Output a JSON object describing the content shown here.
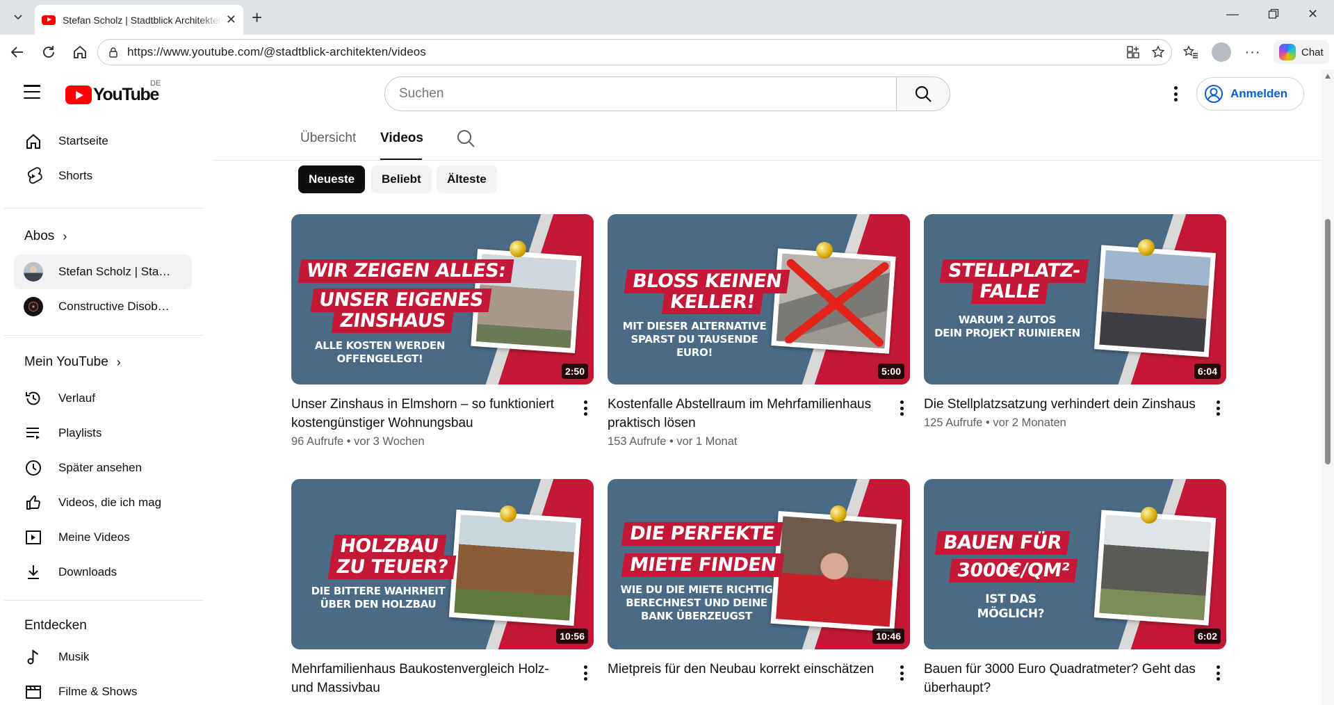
{
  "browser": {
    "tab_title": "Stefan Scholz | Stadtblick Architekten",
    "url_prefix": "https://",
    "url_host": "www.youtube.com",
    "url_path": "/@stadtblick-architekten/videos",
    "chat_label": "Chat"
  },
  "header": {
    "logo_text": "YouTube",
    "country_code": "DE",
    "search_placeholder": "Suchen",
    "signin_label": "Anmelden"
  },
  "sidebar": {
    "main": [
      {
        "label": "Startseite",
        "icon": "home-icon"
      },
      {
        "label": "Shorts",
        "icon": "shorts-icon"
      }
    ],
    "subs_heading": "Abos",
    "subs": [
      {
        "label": "Stefan Scholz | Stadtblick Architekten"
      },
      {
        "label": "Constructive Disobedience"
      }
    ],
    "you_heading": "Mein YouTube",
    "you": [
      {
        "label": "Verlauf",
        "icon": "history-icon"
      },
      {
        "label": "Playlists",
        "icon": "playlists-icon"
      },
      {
        "label": "Später ansehen",
        "icon": "watch-later-icon"
      },
      {
        "label": "Videos, die ich mag",
        "icon": "thumbs-up-icon"
      },
      {
        "label": "Meine Videos",
        "icon": "my-videos-icon"
      },
      {
        "label": "Downloads",
        "icon": "download-icon"
      }
    ],
    "explore_heading": "Entdecken",
    "explore": [
      {
        "label": "Musik",
        "icon": "music-icon"
      },
      {
        "label": "Filme & Shows",
        "icon": "movies-icon"
      }
    ]
  },
  "channel_tabs": [
    "Übersicht",
    "Videos"
  ],
  "chips": [
    "Neueste",
    "Beliebt",
    "Älteste"
  ],
  "videos": [
    {
      "title": "Unser Zinshaus in Elmshorn – so funktioniert kostengünstiger Wohnungsbau",
      "meta": "96 Aufrufe • vor 3 Wochen",
      "duration": "2:50",
      "thumb_lines": [
        "WIR ZEIGEN ALLES:",
        "UNSER EIGENES",
        "ZINSHAUS"
      ],
      "thumb_sub": "ALLE KOSTEN WERDEN\nOFFENGELEGT!"
    },
    {
      "title": "Kostenfalle Abstellraum im Mehrfamilienhaus praktisch lösen",
      "meta": "153 Aufrufe • vor 1 Monat",
      "duration": "5:00",
      "thumb_lines": [
        "BLOSS KEINEN",
        "KELLER!"
      ],
      "thumb_sub": "MIT DIESER ALTERNATIVE\nSPARST DU TAUSENDE EURO!"
    },
    {
      "title": "Die Stellplatzsatzung verhindert dein Zinshaus",
      "meta": "125 Aufrufe • vor 2 Monaten",
      "duration": "6:04",
      "thumb_lines": [
        "STELLPLATZ-",
        "FALLE"
      ],
      "thumb_sub": "WARUM 2 AUTOS\nDEIN PROJEKT RUINIEREN"
    },
    {
      "title": "Mehrfamilienhaus Baukostenvergleich Holz- und Massivbau",
      "meta": "",
      "duration": "10:56",
      "thumb_lines": [
        "HOLZBAU",
        "ZU TEUER?"
      ],
      "thumb_sub": "DIE BITTERE WAHRHEIT\nÜBER DEN HOLZBAU"
    },
    {
      "title": "Mietpreis für den Neubau korrekt einschätzen",
      "meta": "",
      "duration": "10:46",
      "thumb_lines": [
        "DIE PERFEKTE",
        "MIETE FINDEN"
      ],
      "thumb_sub": "WIE DU DIE MIETE RICHTIG\nBERECHNEST UND DEINE\nBANK ÜBERZEUGST"
    },
    {
      "title": "Bauen für 3000 Euro Quadratmeter? Geht das überhaupt?",
      "meta": "",
      "duration": "6:02",
      "thumb_lines": [
        "BAUEN FÜR",
        "3000€/QM²"
      ],
      "thumb_sub": "IST DAS MÖGLICH?"
    }
  ]
}
